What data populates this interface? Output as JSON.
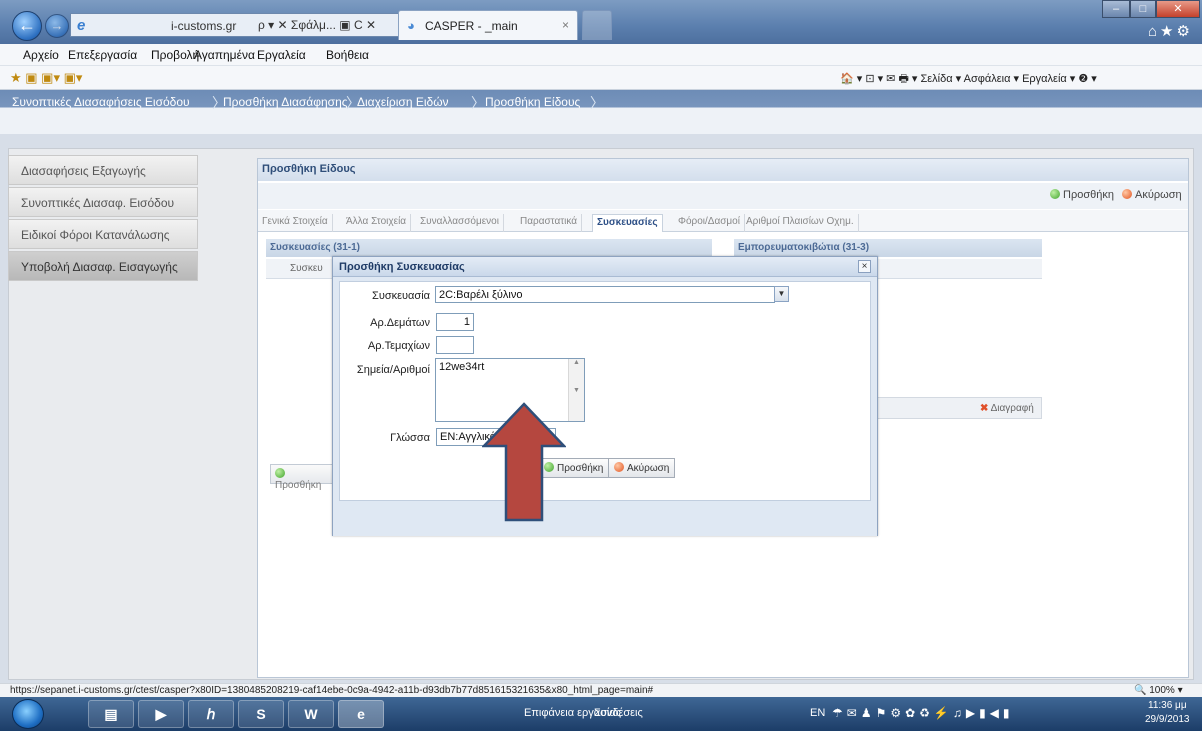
{
  "browser": {
    "address_host": "i-customs.gr",
    "address_tools": "ρ ▾ ✕ Σφάλμ... ▣ C ✕",
    "tab_title": "CASPER - _main",
    "tab_close": "×"
  },
  "menu": [
    "Αρχείο",
    "Επεξεργασία",
    "Προβολή",
    "Αγαπημένα",
    "Εργαλεία",
    "Βοήθεια"
  ],
  "command_bar": "🏠 ▾ ⊡ ▾ ✉ 🖶 ▾ Σελίδα ▾ Ασφάλεια ▾ Εργαλεία ▾ ❷ ▾",
  "breadcrumb": [
    "Συνοπτικές Διασαφήσεις Εισόδου",
    "Προσθήκη Διασάφησης",
    "Διαχείριση Ειδών",
    "Προσθήκη Είδους"
  ],
  "sidebar": {
    "items": [
      {
        "label": "Διασαφήσεις Εξαγωγής"
      },
      {
        "label": "Συνοπτικές Διασαφ. Εισόδου"
      },
      {
        "label": "Ειδικοί Φόροι Κατανάλωσης"
      },
      {
        "label": "Υποβολή Διασαφ. Εισαγωγής"
      }
    ]
  },
  "content": {
    "title": "Προσθήκη Είδους",
    "add_label": "Προσθήκη",
    "cancel_label": "Ακύρωση",
    "tabs": [
      "Γενικά Στοιχεία",
      "Άλλα Στοιχεία",
      "Συναλλασσόμενοι",
      "Παραστατικά",
      "Συσκευασίες",
      "Φόροι/Δασμοί",
      "Αριθμοί Πλαισίων Οχημ."
    ],
    "active_tab": "Συσκευασίες",
    "packages_panel": "Συσκευασίες (31-1)",
    "packages_column": "Συσκευ",
    "containers_panel": "Εμπορευματοκιβώτια (31-3)",
    "delete_label": "Διαγραφή",
    "packages_add": "Προσθήκη"
  },
  "dialog": {
    "title": "Προσθήκη Συσκευασίας",
    "close": "×",
    "package_label": "Συσκευασία",
    "package_value": "2C:Βαρέλι ξύλινο",
    "bundles_label": "Αρ.Δεμάτων",
    "bundles_value": "1",
    "pieces_label": "Αρ.Τεμαχίων",
    "pieces_value": "",
    "marks_label": "Σημεία/Αριθμοί",
    "marks_value": "12we34rt",
    "language_label": "Γλώσσα",
    "language_value": "EN:Αγγλικά",
    "add_button": "Προσθήκη",
    "cancel_button": "Ακύρωση"
  },
  "status": {
    "url": "https://sepanet.i-customs.gr/ctest/casper?x80ID=1380485208219-caf14ebe-0c9a-4942-a11b-d93db7b77d851615321635&x80_html_page=main#",
    "zoom": "100%"
  },
  "taskbar": {
    "desktop": "Επιφάνεια εργασίας",
    "links": "Συνδέσεις",
    "lang": "EN",
    "time": "11:36 μμ",
    "date": "29/9/2013"
  },
  "colors": {
    "arrow_fill": "#b5473f",
    "arrow_stroke": "#2f4f7a"
  }
}
